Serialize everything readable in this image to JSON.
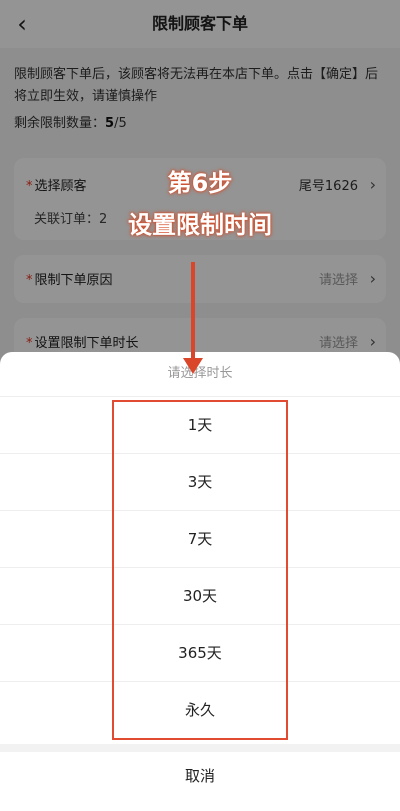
{
  "header": {
    "back_glyph": "‹",
    "title": "限制顾客下单"
  },
  "notice": "限制顾客下单后，该顾客将无法再在本店下单。点击【确定】后将立即生效，请谨慎操作",
  "remaining": {
    "label": "剩余限制数量：",
    "count": "5",
    "total": "/5"
  },
  "customer_card": {
    "label": "选择顾客",
    "value": "尾号1626",
    "sub_label": "关联订单：2"
  },
  "reason_card": {
    "label": "限制下单原因",
    "placeholder": "请选择"
  },
  "duration_card": {
    "label": "设置限制下单时长",
    "placeholder": "请选择"
  },
  "sheet": {
    "title": "请选择时长",
    "options": [
      "1天",
      "3天",
      "7天",
      "30天",
      "365天",
      "永久"
    ],
    "cancel": "取消"
  },
  "annotation": {
    "step": "第6步",
    "text": "设置限制时间"
  },
  "colors": {
    "required": "#e8321e",
    "annotation": "#d9462a",
    "highlight": "#e14b32"
  },
  "icons": {
    "back": "back-arrow-icon",
    "row_arrow": "chevron-right-icon"
  }
}
